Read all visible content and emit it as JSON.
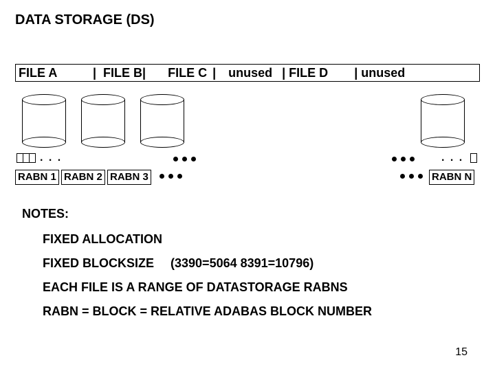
{
  "title": "DATA STORAGE (DS)",
  "header_segments": {
    "file_a": "FILE A",
    "sep1": "|  FILE B|",
    "file_c": "FILE C",
    "sep2": "|",
    "unused1": "unused",
    "sep3": "| FILE D",
    "sep4": "| unused"
  },
  "rabn": {
    "r1": "RABN 1",
    "r2": "RABN 2",
    "r3": "RABN 3",
    "rn": "RABN N"
  },
  "notes_heading": "NOTES:",
  "notes": {
    "n1": "FIXED ALLOCATION",
    "n2a": "FIXED BLOCKSIZE",
    "n2b": "(3390=5064 8391=10796)",
    "n3": "EACH FILE IS A RANGE OF DATASTORAGE RABNS",
    "n4": "RABN = BLOCK = RELATIVE ADABAS BLOCK NUMBER"
  },
  "page_number": "15",
  "ellipsis": ". . ."
}
